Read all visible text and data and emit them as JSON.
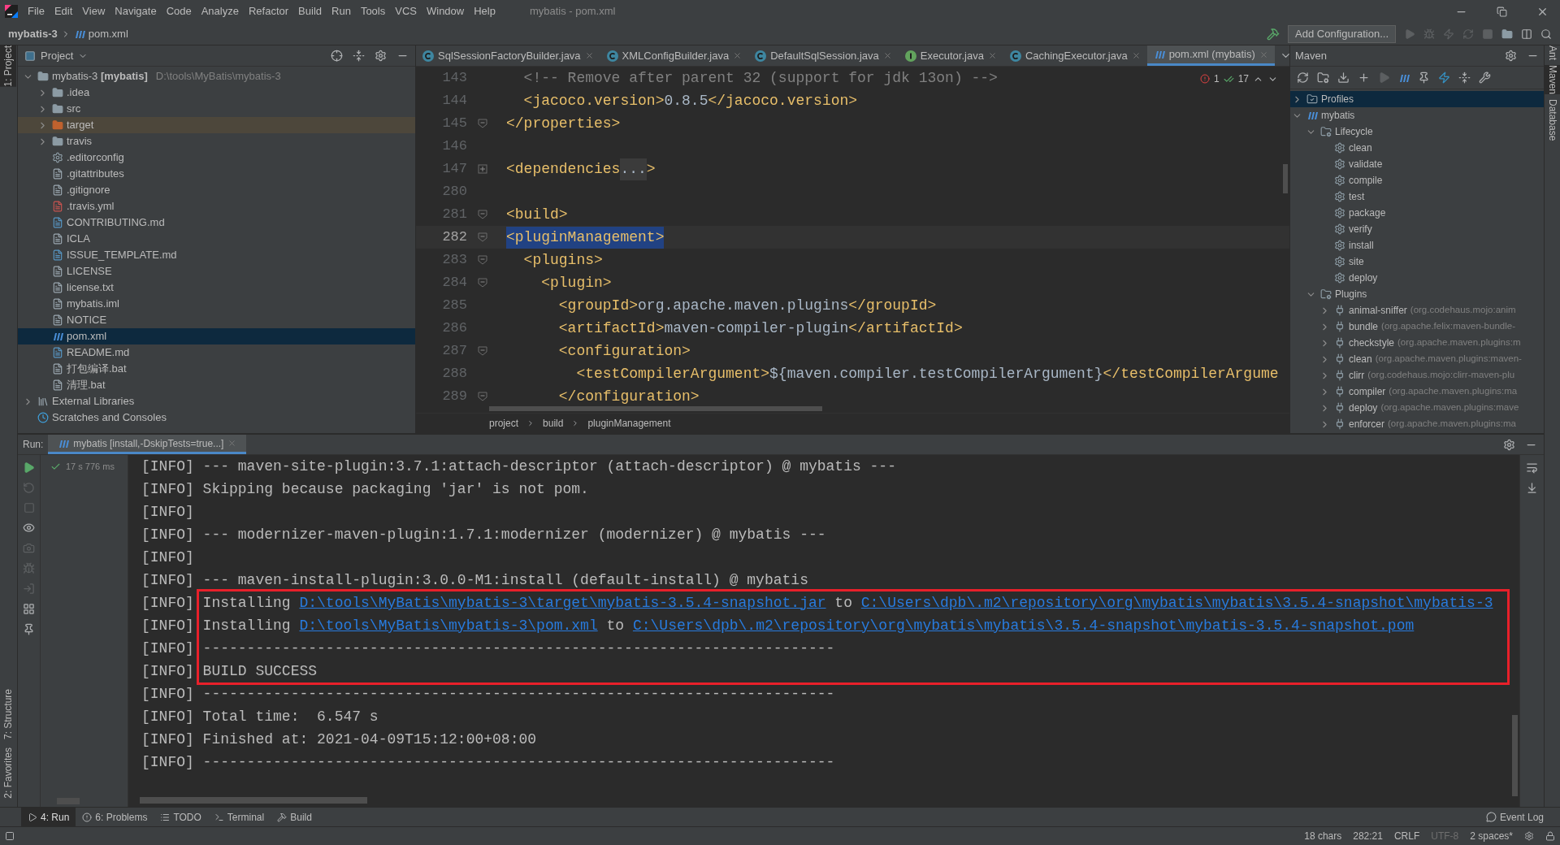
{
  "menu": {
    "items": [
      "File",
      "Edit",
      "View",
      "Navigate",
      "Code",
      "Analyze",
      "Refactor",
      "Build",
      "Run",
      "Tools",
      "VCS",
      "Window",
      "Help"
    ],
    "title": "mybatis - pom.xml"
  },
  "nav": {
    "project": "mybatis-3",
    "file": "pom.xml",
    "run_config": "Add Configuration..."
  },
  "stripe_left": [
    {
      "label": "1: Project",
      "selected": true
    }
  ],
  "stripe_left_bottom": [
    {
      "label": "7: Structure",
      "selected": false
    },
    {
      "label": "2: Favorites",
      "selected": false
    }
  ],
  "project_panel": {
    "title": "Project",
    "tree": [
      {
        "label": "mybatis-3 **[mybatis]**",
        "detail": "D:\\tools\\MyBatis\\mybatis-3",
        "kind": "module",
        "expanded": true,
        "selected": false,
        "children": [
          {
            "label": ".idea",
            "kind": "folder",
            "expanded": false,
            "selected": false
          },
          {
            "label": "src",
            "kind": "folder",
            "expanded": false,
            "selected": false
          },
          {
            "label": "target",
            "kind": "excluded-folder",
            "expanded": false,
            "selected": false
          },
          {
            "label": "travis",
            "kind": "folder",
            "expanded": false,
            "selected": false
          },
          {
            "label": ".editorconfig",
            "kind": "config",
            "selected": false
          },
          {
            "label": ".gitattributes",
            "kind": "text",
            "selected": false
          },
          {
            "label": ".gitignore",
            "kind": "ignore",
            "selected": false
          },
          {
            "label": ".travis.yml",
            "kind": "yml",
            "selected": false
          },
          {
            "label": "CONTRIBUTING.md",
            "kind": "md",
            "selected": false
          },
          {
            "label": "ICLA",
            "kind": "text",
            "selected": false
          },
          {
            "label": "ISSUE_TEMPLATE.md",
            "kind": "md",
            "selected": false
          },
          {
            "label": "LICENSE",
            "kind": "text",
            "selected": false
          },
          {
            "label": "license.txt",
            "kind": "text",
            "selected": false
          },
          {
            "label": "mybatis.iml",
            "kind": "iml",
            "selected": false
          },
          {
            "label": "NOTICE",
            "kind": "text",
            "selected": false
          },
          {
            "label": "pom.xml",
            "kind": "maven",
            "selected": true
          },
          {
            "label": "README.md",
            "kind": "md",
            "selected": false
          },
          {
            "label": "打包编译.bat",
            "kind": "text",
            "selected": false
          },
          {
            "label": "清理.bat",
            "kind": "text",
            "selected": false
          }
        ]
      },
      {
        "label": "External Libraries",
        "kind": "library",
        "expanded": false,
        "selected": false
      },
      {
        "label": "Scratches and Consoles",
        "kind": "scratches",
        "selected": false
      }
    ]
  },
  "editor": {
    "tabs": [
      {
        "label": "SqlSessionFactoryBuilder.java",
        "kind": "class",
        "selected": false
      },
      {
        "label": "XMLConfigBuilder.java",
        "kind": "class",
        "selected": false
      },
      {
        "label": "DefaultSqlSession.java",
        "kind": "class",
        "selected": false
      },
      {
        "label": "Executor.java",
        "kind": "interface",
        "selected": false
      },
      {
        "label": "CachingExecutor.java",
        "kind": "class",
        "selected": false
      },
      {
        "label": "pom.xml (mybatis)",
        "kind": "maven",
        "selected": true
      }
    ],
    "errors": "1",
    "warnings": "17",
    "lines": [
      {
        "number": "143",
        "current": false,
        "kind": "plain",
        "segments": [
          {
            "kind": "comment",
            "text": "  <!-- Remove after parent 32 (support for jdk 13on) -->"
          }
        ]
      },
      {
        "number": "144",
        "current": false,
        "kind": "plain",
        "segments": [
          {
            "kind": "tag",
            "text": "  <jacoco.version>"
          },
          {
            "kind": "text",
            "text": "0.8.5"
          },
          {
            "kind": "tag",
            "text": "</jacoco.version>"
          }
        ]
      },
      {
        "number": "145",
        "current": false,
        "kind": "closer",
        "segments": [
          {
            "kind": "tag",
            "text": "</properties>"
          }
        ]
      },
      {
        "number": "146",
        "current": false,
        "kind": "plain"
      },
      {
        "number": "147",
        "current": false,
        "kind": "collapsed",
        "segments": [
          {
            "kind": "tag",
            "text": "<dependencies"
          },
          {
            "kind": "folded",
            "text": "..."
          },
          {
            "kind": "tag",
            "text": ">"
          }
        ]
      },
      {
        "number": "280",
        "current": false,
        "kind": "plain"
      },
      {
        "number": "281",
        "current": false,
        "kind": "opener",
        "segments": [
          {
            "kind": "tag",
            "text": "<build>"
          }
        ]
      },
      {
        "number": "282",
        "current": true,
        "kind": "opener",
        "segments": [
          {
            "kind": "tag",
            "text": "<pluginManagement>",
            "selected": true
          }
        ]
      },
      {
        "number": "283",
        "current": false,
        "kind": "opener",
        "segments": [
          {
            "kind": "tag",
            "text": "  <plugins>"
          }
        ]
      },
      {
        "number": "284",
        "current": false,
        "kind": "opener",
        "segments": [
          {
            "kind": "tag",
            "text": "    <plugin>"
          }
        ]
      },
      {
        "number": "285",
        "current": false,
        "kind": "plain",
        "segments": [
          {
            "kind": "tag",
            "text": "      <groupId>"
          },
          {
            "kind": "text",
            "text": "org.apache.maven.plugins"
          },
          {
            "kind": "tag",
            "text": "</groupId>"
          }
        ]
      },
      {
        "number": "286",
        "current": false,
        "kind": "plain",
        "segments": [
          {
            "kind": "tag",
            "text": "      <artifactId>"
          },
          {
            "kind": "text",
            "text": "maven-compiler-plugin"
          },
          {
            "kind": "tag",
            "text": "</artifactId>"
          }
        ]
      },
      {
        "number": "287",
        "current": false,
        "kind": "opener",
        "segments": [
          {
            "kind": "tag",
            "text": "      <configuration>"
          }
        ]
      },
      {
        "number": "288",
        "current": false,
        "kind": "plain",
        "segments": [
          {
            "kind": "tag",
            "text": "        <testCompilerArgument>"
          },
          {
            "kind": "text",
            "text": "${maven.compiler.testCompilerArgument}"
          },
          {
            "kind": "tag",
            "text": "</testCompilerArgume"
          }
        ]
      },
      {
        "number": "289",
        "current": false,
        "kind": "closer",
        "segments": [
          {
            "kind": "tag",
            "text": "      </configuration>"
          }
        ]
      }
    ],
    "breadcrumbs": [
      "project",
      "build",
      "pluginManagement"
    ]
  },
  "maven": {
    "title": "Maven",
    "tree": [
      {
        "label": "Profiles",
        "kind": "profiles",
        "expanded": false,
        "selected": true
      },
      {
        "label": "mybatis",
        "kind": "project",
        "expanded": true,
        "selected": false,
        "children": [
          {
            "label": "Lifecycle",
            "kind": "group",
            "expanded": true,
            "selected": false,
            "children": [
              {
                "label": "clean",
                "kind": "goal",
                "selected": false
              },
              {
                "label": "validate",
                "kind": "goal",
                "selected": false
              },
              {
                "label": "compile",
                "kind": "goal",
                "selected": false
              },
              {
                "label": "test",
                "kind": "goal",
                "selected": false
              },
              {
                "label": "package",
                "kind": "goal",
                "selected": false
              },
              {
                "label": "verify",
                "kind": "goal",
                "selected": false
              },
              {
                "label": "install",
                "kind": "goal",
                "selected": false
              },
              {
                "label": "site",
                "kind": "goal",
                "selected": false
              },
              {
                "label": "deploy",
                "kind": "goal",
                "selected": false
              }
            ]
          },
          {
            "label": "Plugins",
            "kind": "group",
            "expanded": true,
            "selected": false,
            "children": [
              {
                "label": "animal-sniffer",
                "detail": "(org.codehaus.mojo:anim",
                "kind": "plugin",
                "expanded": false,
                "selected": false
              },
              {
                "label": "bundle",
                "detail": "(org.apache.felix:maven-bundle-",
                "kind": "plugin",
                "expanded": false,
                "selected": false
              },
              {
                "label": "checkstyle",
                "detail": "(org.apache.maven.plugins:m",
                "kind": "plugin",
                "expanded": false,
                "selected": false
              },
              {
                "label": "clean",
                "detail": "(org.apache.maven.plugins:maven-",
                "kind": "plugin",
                "expanded": false,
                "selected": false
              },
              {
                "label": "clirr",
                "detail": "(org.codehaus.mojo:clirr-maven-plu",
                "kind": "plugin",
                "expanded": false,
                "selected": false
              },
              {
                "label": "compiler",
                "detail": "(org.apache.maven.plugins:ma",
                "kind": "plugin",
                "expanded": false,
                "selected": false
              },
              {
                "label": "deploy",
                "detail": "(org.apache.maven.plugins:mave",
                "kind": "plugin",
                "expanded": false,
                "selected": false
              },
              {
                "label": "enforcer",
                "detail": "(org.apache.maven.plugins:ma",
                "kind": "plugin",
                "expanded": false,
                "selected": false
              }
            ]
          }
        ]
      }
    ]
  },
  "stripe_right": [
    {
      "label": "Ant",
      "selected": false
    },
    {
      "label": "Maven",
      "selected": true
    },
    {
      "label": "Database",
      "selected": false
    }
  ],
  "run": {
    "label": "Run:",
    "tab": {
      "label": "mybatis [install,-DskipTests=true...]",
      "selected": true
    },
    "status": "17 s 776 ms",
    "lines": [
      {
        "segments": [
          {
            "kind": "text",
            "text": "[INFO] --- maven-site-plugin:3.7.1:attach-descriptor (attach-descriptor) @ mybatis ---"
          }
        ]
      },
      {
        "segments": [
          {
            "kind": "text",
            "text": "[INFO] Skipping because packaging 'jar' is not pom."
          }
        ]
      },
      {
        "segments": [
          {
            "kind": "text",
            "text": "[INFO]"
          }
        ]
      },
      {
        "segments": [
          {
            "kind": "text",
            "text": "[INFO] --- modernizer-maven-plugin:1.7.1:modernizer (modernizer) @ mybatis ---"
          }
        ]
      },
      {
        "segments": [
          {
            "kind": "text",
            "text": "[INFO]"
          }
        ]
      },
      {
        "segments": [
          {
            "kind": "text",
            "text": "[INFO] --- maven-install-plugin:3.0.0-M1:install (default-install) @ mybatis"
          }
        ]
      },
      {
        "segments": [
          {
            "kind": "text",
            "text": "[INFO] Installing "
          },
          {
            "kind": "link",
            "text": "D:\\tools\\MyBatis\\mybatis-3\\target\\mybatis-3.5.4-snapshot.jar"
          },
          {
            "kind": "text",
            "text": " to "
          },
          {
            "kind": "link",
            "text": "C:\\Users\\dpb\\.m2\\repository\\org\\mybatis\\mybatis\\3.5.4-snapshot\\mybatis-3"
          }
        ]
      },
      {
        "segments": [
          {
            "kind": "text",
            "text": "[INFO] Installing "
          },
          {
            "kind": "link",
            "text": "D:\\tools\\MyBatis\\mybatis-3\\pom.xml"
          },
          {
            "kind": "text",
            "text": " to "
          },
          {
            "kind": "link",
            "text": "C:\\Users\\dpb\\.m2\\repository\\org\\mybatis\\mybatis\\3.5.4-snapshot\\mybatis-3.5.4-snapshot.pom"
          }
        ]
      },
      {
        "segments": [
          {
            "kind": "text",
            "text": "[INFO] ------------------------------------------------------------------------"
          }
        ]
      },
      {
        "segments": [
          {
            "kind": "text",
            "text": "[INFO] BUILD SUCCESS"
          }
        ]
      },
      {
        "segments": [
          {
            "kind": "text",
            "text": "[INFO] ------------------------------------------------------------------------"
          }
        ]
      },
      {
        "segments": [
          {
            "kind": "text",
            "text": "[INFO] Total time:  6.547 s"
          }
        ]
      },
      {
        "segments": [
          {
            "kind": "text",
            "text": "[INFO] Finished at: 2021-04-09T15:12:00+08:00"
          }
        ]
      },
      {
        "segments": [
          {
            "kind": "text",
            "text": "[INFO] ------------------------------------------------------------------------"
          }
        ]
      }
    ]
  },
  "tool_tabs": [
    {
      "label": "4: Run",
      "kind": "run",
      "selected": true
    },
    {
      "label": "6: Problems",
      "kind": "problems",
      "selected": false
    },
    {
      "label": "TODO",
      "kind": "todo",
      "selected": false
    },
    {
      "label": "Terminal",
      "kind": "terminal",
      "selected": false
    },
    {
      "label": "Build",
      "kind": "build",
      "selected": false
    }
  ],
  "event_log": "Event Log",
  "status_bar": [
    {
      "text": "18 chars",
      "dim": false
    },
    {
      "text": "282:21",
      "dim": false
    },
    {
      "text": "CRLF",
      "dim": false
    },
    {
      "text": "UTF-8",
      "dim": true
    },
    {
      "text": "2 spaces*",
      "dim": false
    }
  ]
}
